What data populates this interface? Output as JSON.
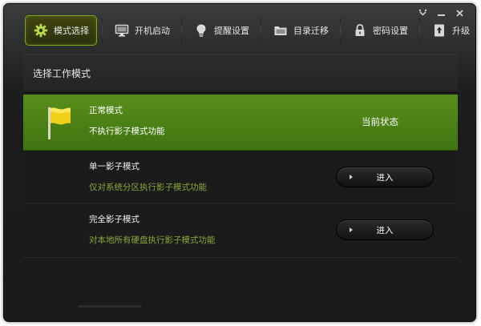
{
  "toolbar": {
    "tabs": [
      {
        "label": "模式选择",
        "icon": "gear-icon",
        "active": true
      },
      {
        "label": "开机启动",
        "icon": "monitor-icon",
        "active": false
      },
      {
        "label": "提醒设置",
        "icon": "bulb-icon",
        "active": false
      },
      {
        "label": "目录迁移",
        "icon": "folder-icon",
        "active": false
      },
      {
        "label": "密码设置",
        "icon": "lock-icon",
        "active": false
      },
      {
        "label": "升级",
        "icon": "upgrade-icon",
        "active": false
      }
    ]
  },
  "window_controls": [
    "menu-icon",
    "minimize-icon",
    "close-icon"
  ],
  "panel": {
    "title": "选择工作模式",
    "modes": [
      {
        "title": "正常模式",
        "desc": "不执行影子模式功能",
        "status": "当前状态",
        "selected": true
      },
      {
        "title": "单一影子模式",
        "desc": "仅对系统分区执行影子模式功能",
        "button": "进入",
        "selected": false
      },
      {
        "title": "完全影子模式",
        "desc": "对本地所有硬盘执行影子模式功能",
        "button": "进入",
        "selected": false
      }
    ]
  },
  "colors": {
    "accent_green": "#5a8e1b",
    "desc_green": "#86a93a",
    "active_tab_border": "#7aa81a",
    "flag_yellow": "#f1d01a"
  }
}
